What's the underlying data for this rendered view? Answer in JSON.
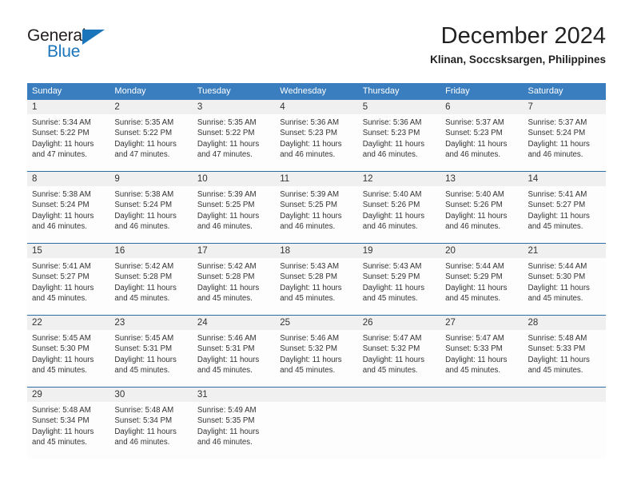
{
  "logo": {
    "word_top": "General",
    "word_bottom": "Blue",
    "triangle_color": "#1b75bb",
    "top_color": "#231f20"
  },
  "header": {
    "title": "December 2024",
    "subtitle": "Klinan, Soccsksargen, Philippines"
  },
  "theme": {
    "header_blue": "#3a7ebf",
    "separator_blue": "#2e6da4",
    "daynum_band": "#f0f0f0",
    "text": "#333333"
  },
  "weekdays": [
    "Sunday",
    "Monday",
    "Tuesday",
    "Wednesday",
    "Thursday",
    "Friday",
    "Saturday"
  ],
  "weeks": [
    [
      {
        "day": "1",
        "sunrise": "Sunrise: 5:34 AM",
        "sunset": "Sunset: 5:22 PM",
        "daylight": "Daylight: 11 hours and 47 minutes."
      },
      {
        "day": "2",
        "sunrise": "Sunrise: 5:35 AM",
        "sunset": "Sunset: 5:22 PM",
        "daylight": "Daylight: 11 hours and 47 minutes."
      },
      {
        "day": "3",
        "sunrise": "Sunrise: 5:35 AM",
        "sunset": "Sunset: 5:22 PM",
        "daylight": "Daylight: 11 hours and 47 minutes."
      },
      {
        "day": "4",
        "sunrise": "Sunrise: 5:36 AM",
        "sunset": "Sunset: 5:23 PM",
        "daylight": "Daylight: 11 hours and 46 minutes."
      },
      {
        "day": "5",
        "sunrise": "Sunrise: 5:36 AM",
        "sunset": "Sunset: 5:23 PM",
        "daylight": "Daylight: 11 hours and 46 minutes."
      },
      {
        "day": "6",
        "sunrise": "Sunrise: 5:37 AM",
        "sunset": "Sunset: 5:23 PM",
        "daylight": "Daylight: 11 hours and 46 minutes."
      },
      {
        "day": "7",
        "sunrise": "Sunrise: 5:37 AM",
        "sunset": "Sunset: 5:24 PM",
        "daylight": "Daylight: 11 hours and 46 minutes."
      }
    ],
    [
      {
        "day": "8",
        "sunrise": "Sunrise: 5:38 AM",
        "sunset": "Sunset: 5:24 PM",
        "daylight": "Daylight: 11 hours and 46 minutes."
      },
      {
        "day": "9",
        "sunrise": "Sunrise: 5:38 AM",
        "sunset": "Sunset: 5:24 PM",
        "daylight": "Daylight: 11 hours and 46 minutes."
      },
      {
        "day": "10",
        "sunrise": "Sunrise: 5:39 AM",
        "sunset": "Sunset: 5:25 PM",
        "daylight": "Daylight: 11 hours and 46 minutes."
      },
      {
        "day": "11",
        "sunrise": "Sunrise: 5:39 AM",
        "sunset": "Sunset: 5:25 PM",
        "daylight": "Daylight: 11 hours and 46 minutes."
      },
      {
        "day": "12",
        "sunrise": "Sunrise: 5:40 AM",
        "sunset": "Sunset: 5:26 PM",
        "daylight": "Daylight: 11 hours and 46 minutes."
      },
      {
        "day": "13",
        "sunrise": "Sunrise: 5:40 AM",
        "sunset": "Sunset: 5:26 PM",
        "daylight": "Daylight: 11 hours and 46 minutes."
      },
      {
        "day": "14",
        "sunrise": "Sunrise: 5:41 AM",
        "sunset": "Sunset: 5:27 PM",
        "daylight": "Daylight: 11 hours and 45 minutes."
      }
    ],
    [
      {
        "day": "15",
        "sunrise": "Sunrise: 5:41 AM",
        "sunset": "Sunset: 5:27 PM",
        "daylight": "Daylight: 11 hours and 45 minutes."
      },
      {
        "day": "16",
        "sunrise": "Sunrise: 5:42 AM",
        "sunset": "Sunset: 5:28 PM",
        "daylight": "Daylight: 11 hours and 45 minutes."
      },
      {
        "day": "17",
        "sunrise": "Sunrise: 5:42 AM",
        "sunset": "Sunset: 5:28 PM",
        "daylight": "Daylight: 11 hours and 45 minutes."
      },
      {
        "day": "18",
        "sunrise": "Sunrise: 5:43 AM",
        "sunset": "Sunset: 5:28 PM",
        "daylight": "Daylight: 11 hours and 45 minutes."
      },
      {
        "day": "19",
        "sunrise": "Sunrise: 5:43 AM",
        "sunset": "Sunset: 5:29 PM",
        "daylight": "Daylight: 11 hours and 45 minutes."
      },
      {
        "day": "20",
        "sunrise": "Sunrise: 5:44 AM",
        "sunset": "Sunset: 5:29 PM",
        "daylight": "Daylight: 11 hours and 45 minutes."
      },
      {
        "day": "21",
        "sunrise": "Sunrise: 5:44 AM",
        "sunset": "Sunset: 5:30 PM",
        "daylight": "Daylight: 11 hours and 45 minutes."
      }
    ],
    [
      {
        "day": "22",
        "sunrise": "Sunrise: 5:45 AM",
        "sunset": "Sunset: 5:30 PM",
        "daylight": "Daylight: 11 hours and 45 minutes."
      },
      {
        "day": "23",
        "sunrise": "Sunrise: 5:45 AM",
        "sunset": "Sunset: 5:31 PM",
        "daylight": "Daylight: 11 hours and 45 minutes."
      },
      {
        "day": "24",
        "sunrise": "Sunrise: 5:46 AM",
        "sunset": "Sunset: 5:31 PM",
        "daylight": "Daylight: 11 hours and 45 minutes."
      },
      {
        "day": "25",
        "sunrise": "Sunrise: 5:46 AM",
        "sunset": "Sunset: 5:32 PM",
        "daylight": "Daylight: 11 hours and 45 minutes."
      },
      {
        "day": "26",
        "sunrise": "Sunrise: 5:47 AM",
        "sunset": "Sunset: 5:32 PM",
        "daylight": "Daylight: 11 hours and 45 minutes."
      },
      {
        "day": "27",
        "sunrise": "Sunrise: 5:47 AM",
        "sunset": "Sunset: 5:33 PM",
        "daylight": "Daylight: 11 hours and 45 minutes."
      },
      {
        "day": "28",
        "sunrise": "Sunrise: 5:48 AM",
        "sunset": "Sunset: 5:33 PM",
        "daylight": "Daylight: 11 hours and 45 minutes."
      }
    ],
    [
      {
        "day": "29",
        "sunrise": "Sunrise: 5:48 AM",
        "sunset": "Sunset: 5:34 PM",
        "daylight": "Daylight: 11 hours and 45 minutes."
      },
      {
        "day": "30",
        "sunrise": "Sunrise: 5:48 AM",
        "sunset": "Sunset: 5:34 PM",
        "daylight": "Daylight: 11 hours and 46 minutes."
      },
      {
        "day": "31",
        "sunrise": "Sunrise: 5:49 AM",
        "sunset": "Sunset: 5:35 PM",
        "daylight": "Daylight: 11 hours and 46 minutes."
      },
      {
        "day": "",
        "sunrise": "",
        "sunset": "",
        "daylight": ""
      },
      {
        "day": "",
        "sunrise": "",
        "sunset": "",
        "daylight": ""
      },
      {
        "day": "",
        "sunrise": "",
        "sunset": "",
        "daylight": ""
      },
      {
        "day": "",
        "sunrise": "",
        "sunset": "",
        "daylight": ""
      }
    ]
  ]
}
